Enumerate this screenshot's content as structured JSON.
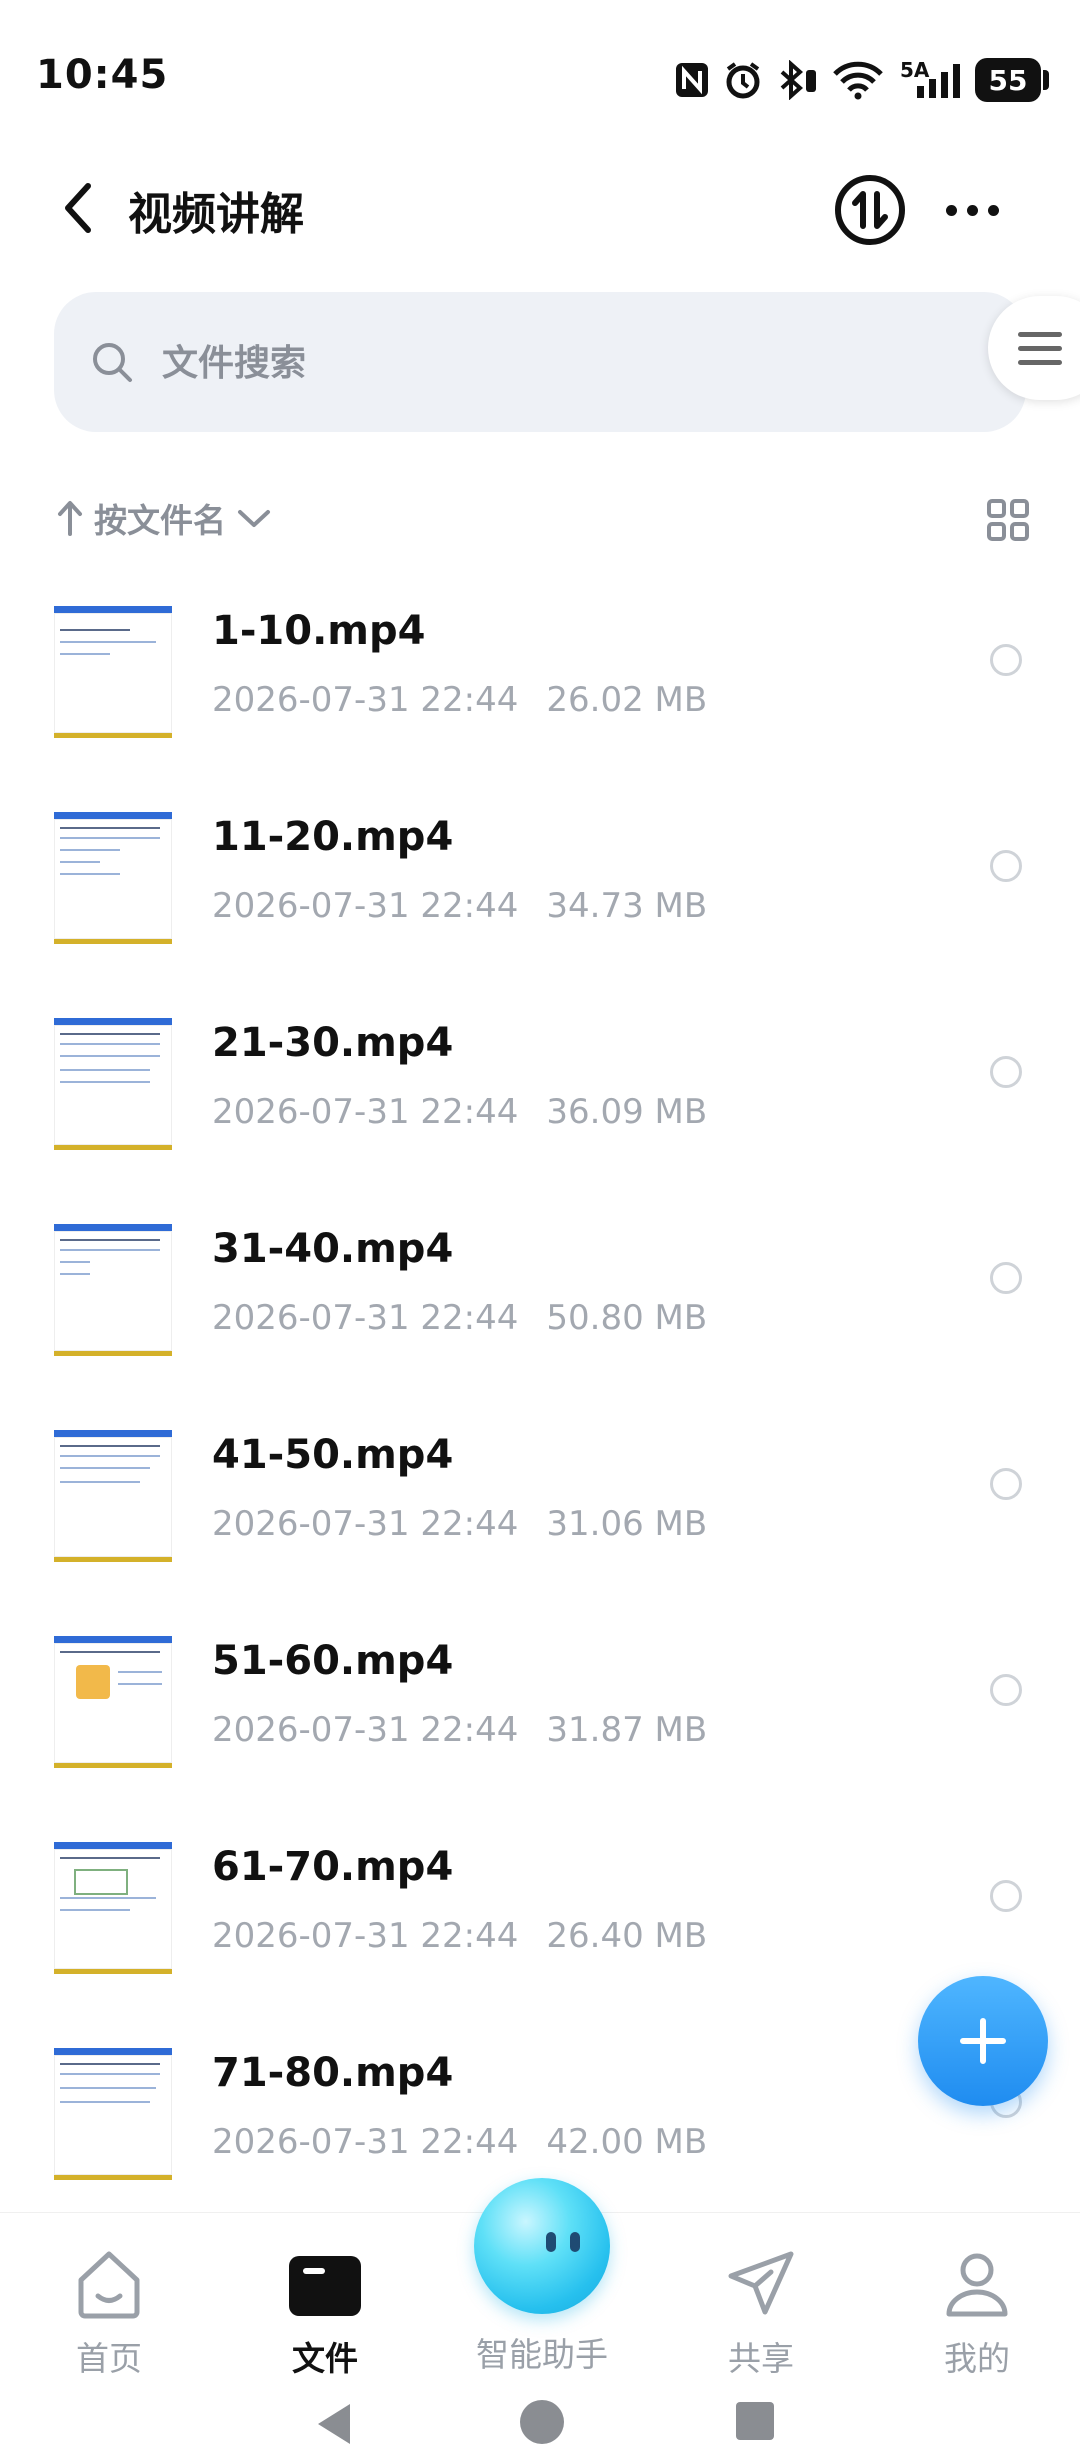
{
  "status_bar": {
    "time": "10:45",
    "network_label": "5A",
    "battery": "55",
    "icons": [
      "nfc-icon",
      "alarm-icon",
      "bluetooth-icon",
      "wifi-icon",
      "signal-icon",
      "battery-icon"
    ]
  },
  "header": {
    "title": "视频讲解",
    "back_icon": "chevron-left-icon",
    "sort_switch_icon": "swap-vertical-icon",
    "more_icon": "more-horizontal-icon"
  },
  "search": {
    "placeholder": "文件搜索",
    "value": ""
  },
  "sort": {
    "label": "按文件名",
    "direction_icon": "arrow-up-icon",
    "dropdown_icon": "chevron-down-icon",
    "view_toggle_icon": "grid-view-icon"
  },
  "files": [
    {
      "name": "1-10.mp4",
      "date": "2026-07-31 22:44",
      "size": "26.02 MB"
    },
    {
      "name": "11-20.mp4",
      "date": "2026-07-31 22:44",
      "size": "34.73 MB"
    },
    {
      "name": "21-30.mp4",
      "date": "2026-07-31 22:44",
      "size": "36.09 MB"
    },
    {
      "name": "31-40.mp4",
      "date": "2026-07-31 22:44",
      "size": "50.80 MB"
    },
    {
      "name": "41-50.mp4",
      "date": "2026-07-31 22:44",
      "size": "31.06 MB"
    },
    {
      "name": "51-60.mp4",
      "date": "2026-07-31 22:44",
      "size": "31.87 MB"
    },
    {
      "name": "61-70.mp4",
      "date": "2026-07-31 22:44",
      "size": "26.40 MB"
    },
    {
      "name": "71-80.mp4",
      "date": "2026-07-31 22:44",
      "size": "42.00 MB"
    }
  ],
  "fab": {
    "icon": "plus-icon"
  },
  "bottom_nav": {
    "items": [
      {
        "label": "首页",
        "icon": "home-icon",
        "active": false
      },
      {
        "label": "文件",
        "icon": "folder-icon",
        "active": true
      },
      {
        "label": "智能助手",
        "icon": "assistant-orb-icon",
        "active": false
      },
      {
        "label": "共享",
        "icon": "send-icon",
        "active": false
      },
      {
        "label": "我的",
        "icon": "person-icon",
        "active": false
      }
    ]
  },
  "colors": {
    "accent": "#1f8cf0",
    "search_bg": "#eef1f6",
    "meta_text": "#a3a8b0",
    "active_nav": "#111111"
  }
}
